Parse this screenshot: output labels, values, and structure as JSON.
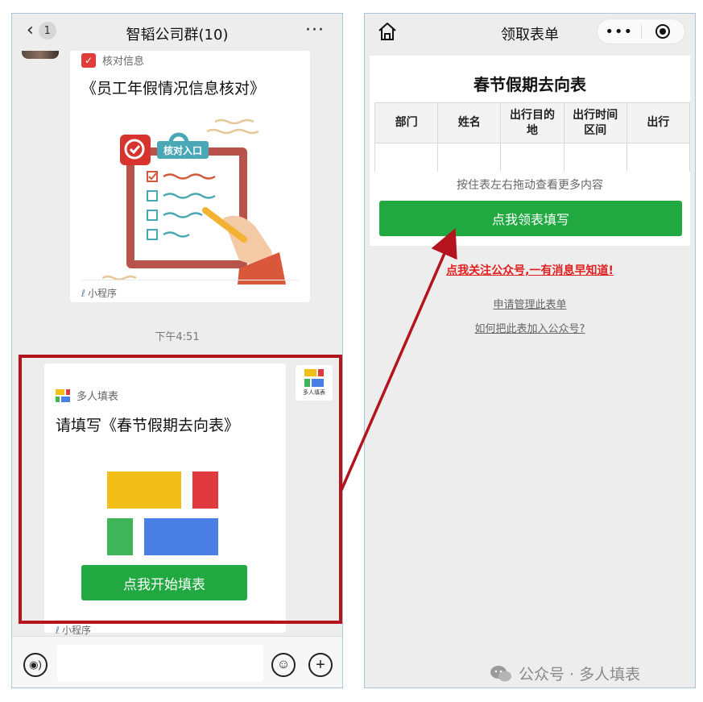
{
  "chat": {
    "unread_count": "1",
    "title": "智韬公司群(10)",
    "more": "···",
    "timestamp": "下午4:51"
  },
  "card_verify": {
    "source": "核对信息",
    "title": "《员工年假情况信息核对》",
    "entry_tag": "核对入口",
    "footer": "小程序"
  },
  "card_form": {
    "source": "多人填表",
    "title": "请填写《春节假期去向表》",
    "button": "点我开始填表",
    "footer": "小程序",
    "avatar_caption": "多人填表"
  },
  "form_page": {
    "title": "领取表单",
    "heading": "春节假期去向表",
    "columns": [
      "部门",
      "姓名",
      "出行目的地",
      "出行时间区间",
      "出行"
    ],
    "hint": "按住表左右拖动查看更多内容",
    "button": "点我领表填写",
    "follow_link": "点我关注公众号,一有消息早知道!",
    "manage_link": "申请管理此表单",
    "howto_link": "如何把此表加入公众号?"
  },
  "watermark": {
    "text": "公众号 · 多人填表"
  },
  "colors": {
    "primary_green": "#21a840",
    "highlight_red": "#b3141d",
    "link_red": "#e0201f",
    "block_yellow": "#f2bf1a",
    "block_red": "#e03a3e",
    "block_green": "#3fb55a",
    "block_blue": "#4a7fe6"
  }
}
